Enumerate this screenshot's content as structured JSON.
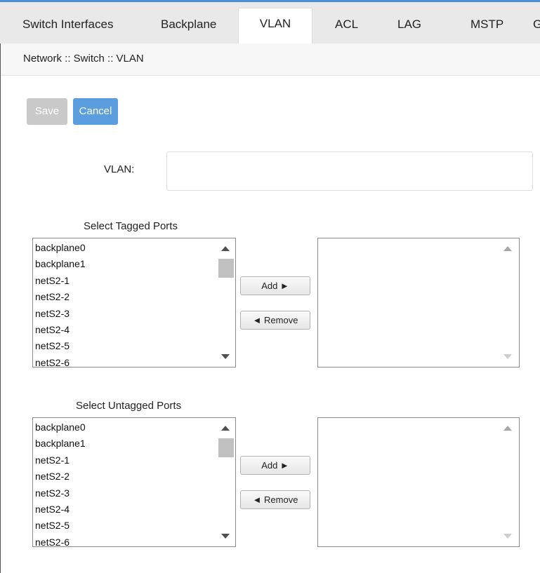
{
  "tabs": [
    {
      "label": "Switch Interfaces",
      "active": false
    },
    {
      "label": "Backplane",
      "active": false
    },
    {
      "label": "VLAN",
      "active": true
    },
    {
      "label": "ACL",
      "active": false
    },
    {
      "label": "LAG",
      "active": false
    },
    {
      "label": "MSTP",
      "active": false
    },
    {
      "label": "G",
      "active": false
    }
  ],
  "breadcrumb": "Network :: Switch :: VLAN",
  "buttons": {
    "save": "Save",
    "cancel": "Cancel"
  },
  "vlan": {
    "label": "VLAN:",
    "value": ""
  },
  "tagged": {
    "title": "Select Tagged Ports",
    "ports": [
      "backplane0",
      "backplane1",
      "netS2-1",
      "netS2-2",
      "netS2-3",
      "netS2-4",
      "netS2-5",
      "netS2-6"
    ],
    "add_label": "Add ►",
    "remove_label": "◄ Remove"
  },
  "untagged": {
    "title": "Select Untagged Ports",
    "ports": [
      "backplane0",
      "backplane1",
      "netS2-1",
      "netS2-2",
      "netS2-3",
      "netS2-4",
      "netS2-5",
      "netS2-6"
    ],
    "add_label": "Add ►",
    "remove_label": "◄ Remove"
  },
  "colors": {
    "accent": "#4a90d9",
    "cancel": "#5a9ee0",
    "save_disabled": "#c9c9c9"
  }
}
